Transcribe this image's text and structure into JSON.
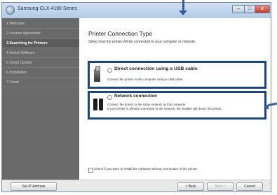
{
  "window": {
    "title": "Samsung CLX-4190 Series",
    "controls": {
      "minimize": "–",
      "maximize": "□",
      "close": "x"
    }
  },
  "sidebar": {
    "items": [
      {
        "label": "1.Welcome",
        "active": false
      },
      {
        "label": "2.License Agreement",
        "active": false
      },
      {
        "label": "3.Searching for Printers",
        "active": true
      },
      {
        "label": "4.Select Software",
        "active": false
      },
      {
        "label": "5.Smart Update",
        "active": false
      },
      {
        "label": "6.Installation",
        "active": false
      },
      {
        "label": "7.Finish",
        "active": false
      }
    ]
  },
  "main": {
    "title": "Printer Connection Type",
    "subtitle": "Select how the printer will be connected to your computer or network."
  },
  "options": {
    "usb": {
      "label": "Direct connection using a USB cable",
      "description": "Connect the printer to this computer using a USB cable.",
      "icon": "usb-cable-icon",
      "selected": false
    },
    "network": {
      "label": "Network connection",
      "description_line1": "Connect the printer to the same network as this computer.",
      "description_line2": "If your printer is already connected to the network, the installer will detect the printer.",
      "icon": "network-icon",
      "selected": false
    }
  },
  "checkbox": {
    "label": "Check if you want to install the software without connection of the printer.",
    "checked": false
  },
  "footer": {
    "set_ip": "Set IP Address",
    "back": "< Back",
    "next": "Next >",
    "cancel": "Cancel"
  },
  "colors": {
    "sidebar_bg": "#6a6a6a",
    "highlight_border": "#1c4587",
    "arrow": "#3a5b99"
  }
}
